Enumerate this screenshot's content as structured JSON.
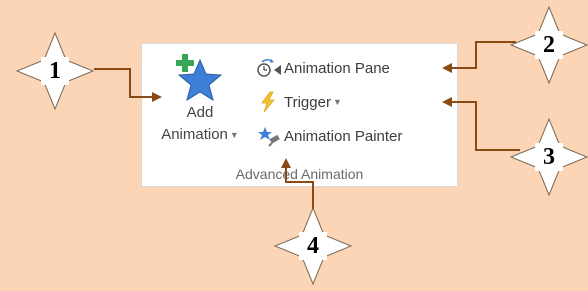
{
  "ribbon": {
    "group_label": "Advanced Animation",
    "add_animation": {
      "line1": "Add",
      "line2": "Animation",
      "icon": "add-animation-star-icon"
    },
    "commands": [
      {
        "label": "Animation Pane",
        "icon": "animation-pane-icon",
        "has_dropdown": false
      },
      {
        "label": "Trigger",
        "icon": "lightning-bolt-icon",
        "has_dropdown": true
      },
      {
        "label": "Animation Painter",
        "icon": "animation-painter-icon",
        "has_dropdown": false
      }
    ]
  },
  "callouts": [
    {
      "number": "1"
    },
    {
      "number": "2"
    },
    {
      "number": "3"
    },
    {
      "number": "4"
    }
  ],
  "colors": {
    "background": "#fbd5b5",
    "arrow": "#8b4a13",
    "star_blue": "#3d7fd6",
    "plus_green": "#3aa655",
    "bolt_yellow": "#f2c230"
  }
}
